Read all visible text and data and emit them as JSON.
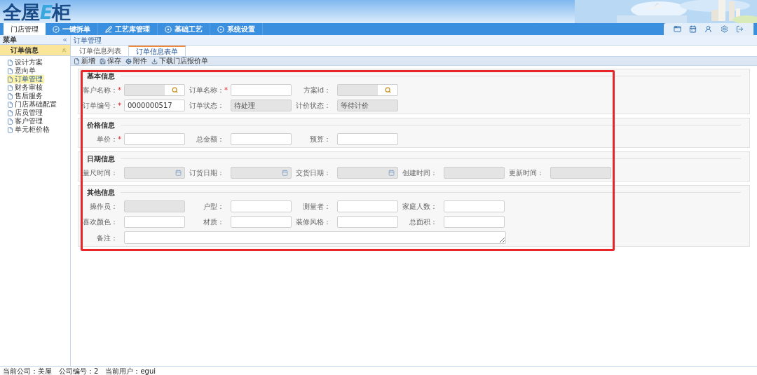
{
  "logo": [
    {
      "text": "全屋",
      "accent": false
    },
    {
      "text": "E",
      "accent": true
    },
    {
      "text": "柜",
      "accent": false
    }
  ],
  "nav": [
    {
      "label": "门店管理",
      "selected": true
    },
    {
      "label": "一键拆单",
      "selected": false
    },
    {
      "label": "工艺库管理",
      "selected": false
    },
    {
      "label": "基础工艺",
      "selected": false
    },
    {
      "label": "系统设置",
      "selected": false
    }
  ],
  "sidebar": {
    "title": "菜单",
    "collapse": "«",
    "section": {
      "title": "订单信息",
      "expanded": true
    },
    "items": [
      {
        "label": "设计方案",
        "selected": false
      },
      {
        "label": "意向单",
        "selected": false
      },
      {
        "label": "订单管理",
        "selected": true
      },
      {
        "label": "财务审核",
        "selected": false
      },
      {
        "label": "售后服务",
        "selected": false
      },
      {
        "label": "门店基础配置",
        "selected": false
      },
      {
        "label": "店员管理",
        "selected": false
      },
      {
        "label": "客户管理",
        "selected": false
      },
      {
        "label": "单元柜价格",
        "selected": false
      }
    ]
  },
  "breadcrumb": "订单管理",
  "tabs": [
    {
      "label": "订单信息列表",
      "selected": false
    },
    {
      "label": "订单信息表单",
      "selected": true
    }
  ],
  "toolbar": [
    {
      "label": "新增"
    },
    {
      "label": "保存"
    },
    {
      "label": "附件"
    },
    {
      "label": "下载门店报价单"
    }
  ],
  "sections": [
    {
      "title": "基本信息",
      "rows": [
        [
          {
            "label": "客户名称：",
            "required_mark": "*",
            "kind": "lookup"
          },
          {
            "label": "订单名称：",
            "required_mark": "*",
            "kind": "text"
          },
          {
            "label": "方案id：",
            "kind": "lookup"
          }
        ],
        [
          {
            "label": "订单编号：",
            "required_mark": "*",
            "kind": "text",
            "value": "0000000517"
          },
          {
            "label": "订单状态：",
            "kind": "readonly",
            "value": "待处理"
          },
          {
            "label": "计价状态：",
            "kind": "readonly",
            "value": "等待计价"
          }
        ]
      ]
    },
    {
      "title": "价格信息",
      "rows": [
        [
          {
            "label": "单价：",
            "required_mark": "*",
            "kind": "text"
          },
          {
            "label": "总金额：",
            "kind": "text"
          },
          {
            "label": "预算：",
            "kind": "text"
          }
        ]
      ]
    },
    {
      "title": "日期信息",
      "rows": [
        [
          {
            "label": "量尺时间：",
            "kind": "date"
          },
          {
            "label": "订货日期：",
            "kind": "date"
          },
          {
            "label": "交货日期：",
            "kind": "date"
          },
          {
            "label": "创建时间：",
            "kind": "readonly"
          },
          {
            "label": "更新时间：",
            "kind": "readonly"
          }
        ]
      ]
    },
    {
      "title": "其他信息",
      "rows": [
        [
          {
            "label": "操作员：",
            "kind": "readonly"
          },
          {
            "label": "户型：",
            "kind": "text"
          },
          {
            "label": "测量者：",
            "kind": "text"
          },
          {
            "label": "家庭人数：",
            "kind": "text"
          }
        ],
        [
          {
            "label": "喜欢颜色：",
            "kind": "text"
          },
          {
            "label": "材质：",
            "kind": "text"
          },
          {
            "label": "装修风格：",
            "kind": "text"
          },
          {
            "label": "总面积：",
            "kind": "text"
          }
        ],
        [
          {
            "label": "备注：",
            "kind": "textarea"
          }
        ]
      ]
    }
  ],
  "status_bar": [
    "当前公司：美屋",
    "公司编号：2",
    "当前用户：egui"
  ]
}
